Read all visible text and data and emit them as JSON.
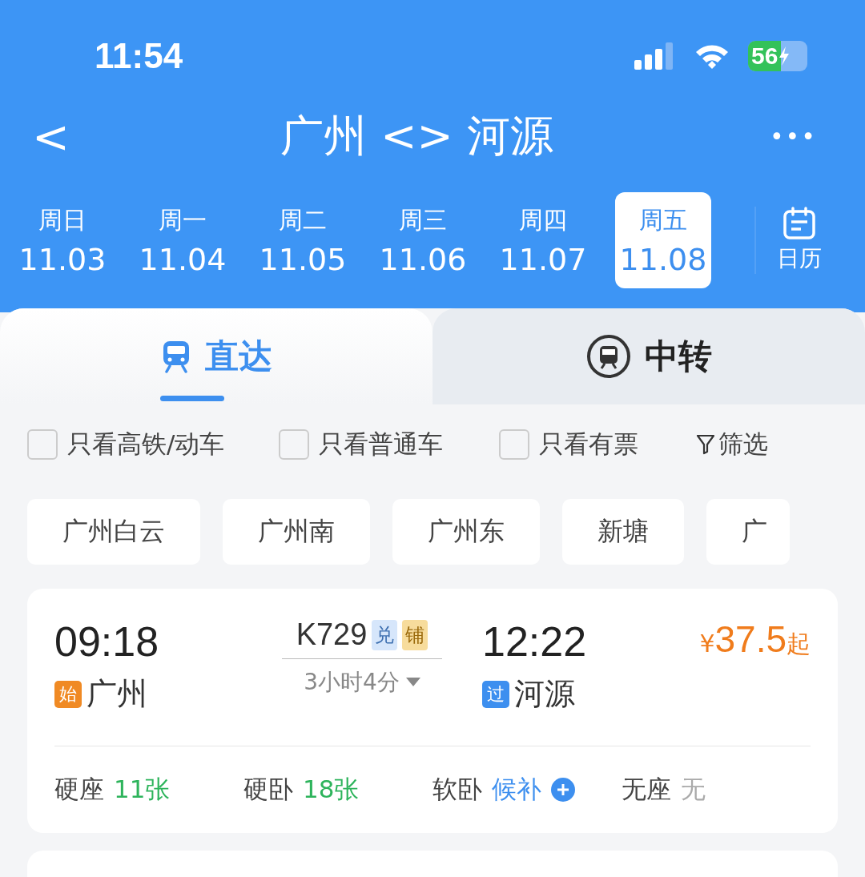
{
  "status_bar": {
    "time": "11:54",
    "battery": "56"
  },
  "nav": {
    "back": "<",
    "title": "广州 <> 河源",
    "more": "•••"
  },
  "dates": [
    {
      "weekday": "周日",
      "date": "11.03",
      "selected": false
    },
    {
      "weekday": "周一",
      "date": "11.04",
      "selected": false
    },
    {
      "weekday": "周二",
      "date": "11.05",
      "selected": false
    },
    {
      "weekday": "周三",
      "date": "11.06",
      "selected": false
    },
    {
      "weekday": "周四",
      "date": "11.07",
      "selected": false
    },
    {
      "weekday": "周五",
      "date": "11.08",
      "selected": true
    }
  ],
  "calendar": {
    "label": "日历"
  },
  "tabs": [
    {
      "label": "直达",
      "selected": true
    },
    {
      "label": "中转",
      "selected": false
    }
  ],
  "filters": [
    {
      "label": "只看高铁/动车",
      "checked": false
    },
    {
      "label": "只看普通车",
      "checked": false
    },
    {
      "label": "只看有票",
      "checked": false
    }
  ],
  "filter_button": "筛选",
  "stations": [
    "广州白云",
    "广州南",
    "广州东",
    "新塘",
    "广"
  ],
  "trains": [
    {
      "depart_time": "09:18",
      "depart_tag": {
        "text": "始",
        "color": "#f08a24"
      },
      "depart_station": "广州",
      "train_no": "K729",
      "badges": [
        {
          "text": "兑",
          "color": "#d6e6fb"
        },
        {
          "text": "铺",
          "color": "#f7dc9c"
        }
      ],
      "duration": "3小时4分",
      "arrive_time": "12:22",
      "arrive_tag": {
        "text": "过",
        "color": "#3d8fef"
      },
      "arrive_station": "河源",
      "price": {
        "currency": "¥",
        "amount": "37.5",
        "suffix": "起"
      },
      "seats": [
        {
          "name": "硬座",
          "value": "11张",
          "kind": "count"
        },
        {
          "name": "硬卧",
          "value": "18张",
          "kind": "count"
        },
        {
          "name": "软卧",
          "value": "候补",
          "kind": "waitlist"
        },
        {
          "name": "无座",
          "value": "无",
          "kind": "none"
        }
      ]
    }
  ]
}
